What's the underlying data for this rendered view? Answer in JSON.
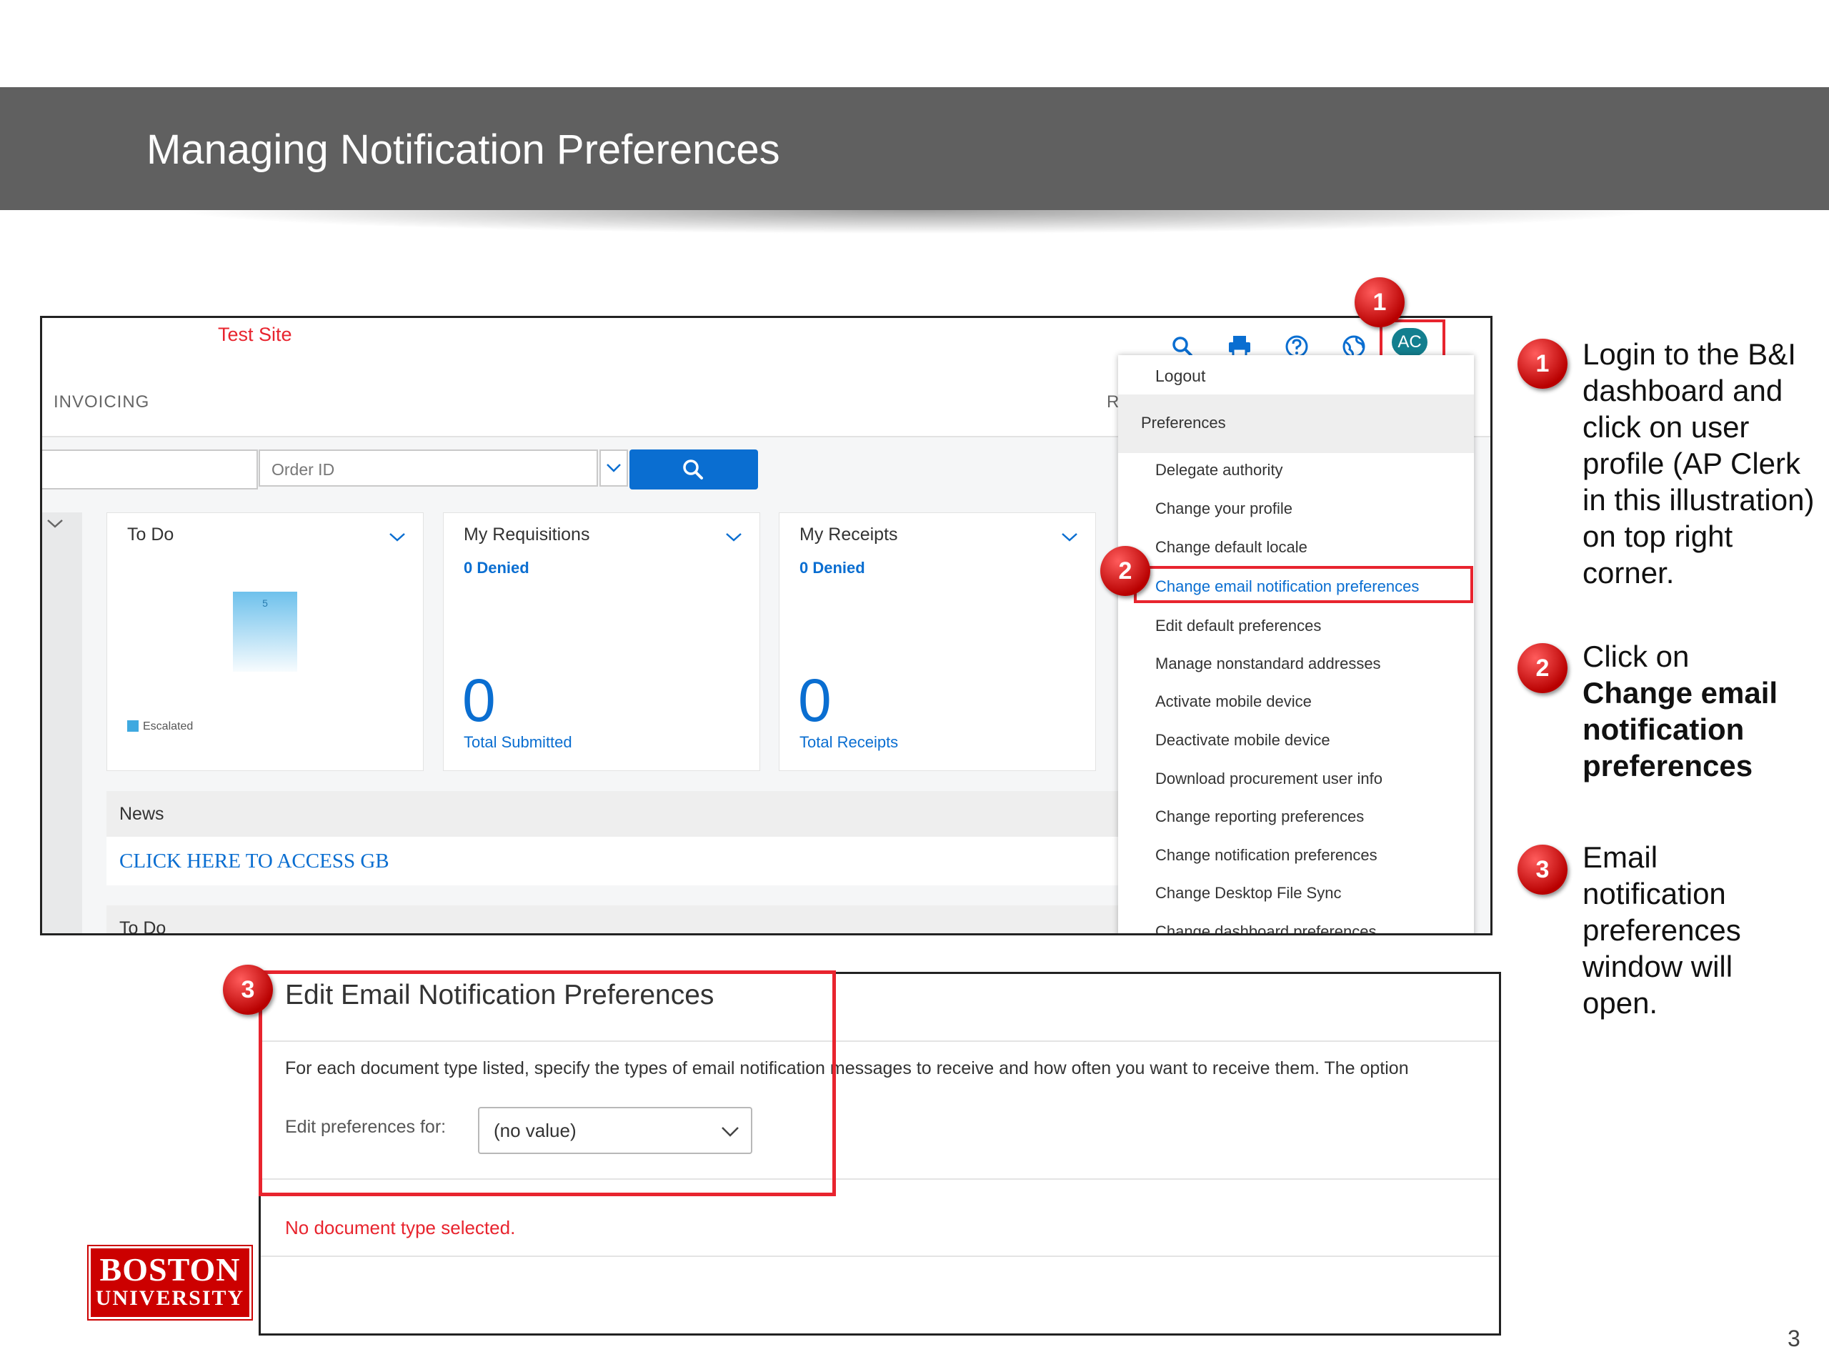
{
  "slide": {
    "title": "Managing Notification Preferences",
    "page_number": "3"
  },
  "dashboard": {
    "site_label": "Test Site",
    "nav": {
      "invoicing": "INVOICING",
      "partial_tab": "R"
    },
    "search": {
      "order_placeholder": "Order ID"
    },
    "cards": {
      "todo": {
        "title": "To Do",
        "bar_value": "5",
        "legend": "Escalated"
      },
      "requisitions": {
        "title": "My Requisitions",
        "denied": "0 Denied",
        "count": "0",
        "count_label": "Total Submitted"
      },
      "receipts": {
        "title": "My Receipts",
        "denied": "0 Denied",
        "count": "0",
        "count_label": "Total Receipts"
      }
    },
    "news": {
      "label": "News",
      "link": "CLICK HERE TO ACCESS GB"
    },
    "todo_section": {
      "label": "To Do"
    },
    "avatar_initials": "AC",
    "icons": [
      "search-icon",
      "print-icon",
      "help-icon",
      "globe-icon"
    ]
  },
  "menu": {
    "logout": "Logout",
    "preferences_header": "Preferences",
    "items": [
      "Delegate authority",
      "Change your profile",
      "Change default locale",
      "Change email notification preferences",
      "Edit default preferences",
      "Manage nonstandard addresses",
      "Activate mobile device",
      "Deactivate mobile device",
      "Download procurement user info",
      "Change reporting preferences",
      "Change notification preferences",
      "Change Desktop File Sync",
      "Change dashboard preferences"
    ]
  },
  "email_prefs": {
    "title": "Edit Email Notification Preferences",
    "instructions": "For each document type listed, specify the types of email notification messages to receive and how often you want to receive them. The option",
    "edit_for_label": "Edit preferences for:",
    "select_value": "(no value)",
    "empty_message": "No document type selected."
  },
  "steps": [
    {
      "number": "1",
      "text": "Login to the B&I dashboard and click on user profile (AP Clerk in this illustration) on top right corner."
    },
    {
      "number": "2",
      "prefix": "Click on",
      "bold": "Change email notification preferences"
    },
    {
      "number": "3",
      "text": "Email notification preferences window will open."
    }
  ],
  "logo": {
    "line1": "BOSTON",
    "line2": "UNIVERSITY"
  },
  "colors": {
    "accent_blue": "#0a6ed1",
    "highlight_red": "#e8242e",
    "banner_gray": "#606060",
    "avatar_teal": "#137f8f",
    "bu_red": "#cc0000"
  }
}
